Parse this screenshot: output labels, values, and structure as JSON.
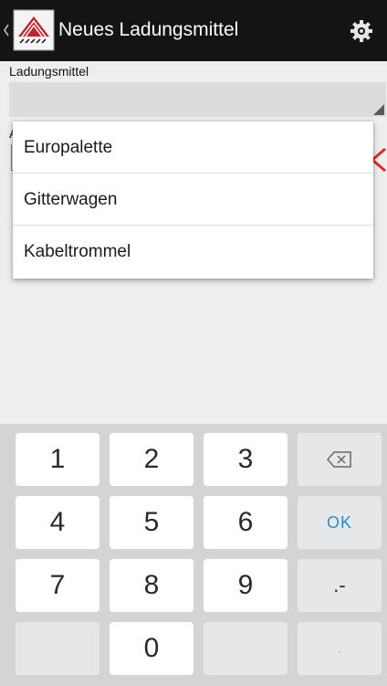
{
  "actionbar": {
    "title": "Neues Ladungsmittel"
  },
  "form": {
    "field_label": "Ladungsmittel",
    "field2_label_partial": "A"
  },
  "dropdown": {
    "options": [
      "Europalette",
      "Gitterwagen",
      "Kabeltrommel"
    ]
  },
  "keyboard": {
    "keys": [
      "1",
      "2",
      "3",
      "4",
      "5",
      "6",
      "7",
      "8",
      "9",
      "0"
    ],
    "ok_label": "OK",
    "dot_dash_label": ".-",
    "comma_label": ","
  },
  "colors": {
    "actionbar_bg": "#141414",
    "background": "#eeeeee",
    "keyboard_bg": "#d2d4d6",
    "ok_text": "#2b8cc4",
    "clear_x": "#e8272a"
  },
  "icons": [
    "back-chevron-icon",
    "app-logo-icon",
    "settings-gear-icon",
    "clear-x-icon",
    "backspace-icon"
  ]
}
